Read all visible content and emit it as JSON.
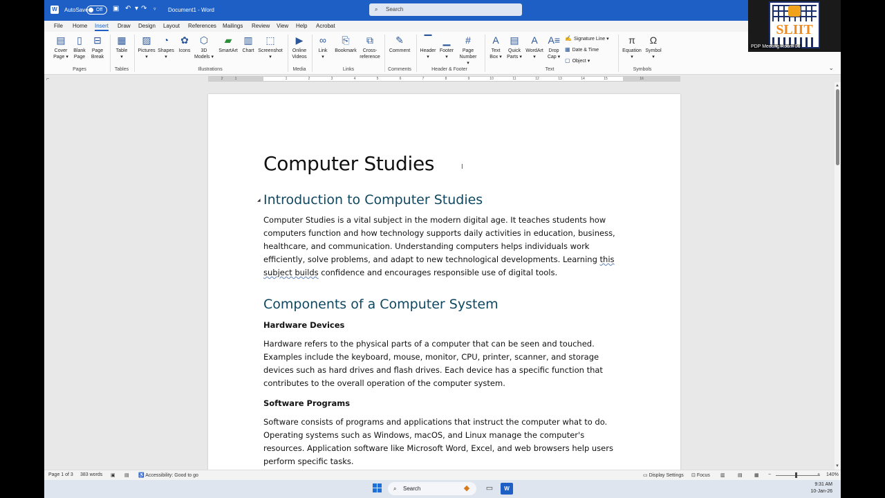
{
  "titlebar": {
    "autosave_label": "AutoSave",
    "autosave_state": "Off",
    "doc_title": "Document1 - Word",
    "search_placeholder": "Search"
  },
  "tabs": [
    "File",
    "Home",
    "Insert",
    "Draw",
    "Design",
    "Layout",
    "References",
    "Mailings",
    "Review",
    "View",
    "Help",
    "Acrobat"
  ],
  "active_tab": "Insert",
  "ribbon": {
    "cover_page": [
      "Cover",
      "Page ▾"
    ],
    "blank_page": [
      "Blank",
      "Page"
    ],
    "page_break": [
      "Page",
      "Break"
    ],
    "table": "Table",
    "pictures": "Pictures",
    "shapes": "Shapes",
    "icons": "Icons",
    "models_3d": [
      "3D",
      "Models ▾"
    ],
    "smartart": "SmartArt",
    "chart": "Chart",
    "screenshot": "Screenshot",
    "online_videos": [
      "Online",
      "Videos"
    ],
    "link": "Link",
    "bookmark": "Bookmark",
    "cross_reference": [
      "Cross-",
      "reference"
    ],
    "comment": "Comment",
    "header": "Header",
    "footer": "Footer",
    "page_number": [
      "Page",
      "Number ▾"
    ],
    "text_box": [
      "Text",
      "Box ▾"
    ],
    "quick_parts": [
      "Quick",
      "Parts ▾"
    ],
    "wordart": "WordArt",
    "drop_cap": [
      "Drop",
      "Cap ▾"
    ],
    "signature_line": "Signature Line",
    "date_time": "Date & Time",
    "object": "Object",
    "equation": "Equation",
    "symbol": "Symbol",
    "groups": {
      "pages": "Pages",
      "tables": "Tables",
      "illustrations": "Illustrations",
      "media": "Media",
      "links": "Links",
      "comments": "Comments",
      "header_footer": "Header & Footer",
      "text": "Text",
      "symbols": "Symbols"
    }
  },
  "ruler_numbers": [
    "1",
    "2",
    "1",
    "2",
    "3",
    "4",
    "5",
    "6",
    "7",
    "8",
    "9",
    "10",
    "11",
    "12",
    "13",
    "14",
    "15",
    "16"
  ],
  "document": {
    "title": "Computer Studies",
    "h1_intro": "Introduction to Computer Studies",
    "intro_para_main": "Computer Studies is a vital subject in the modern digital age. It teaches students how computers function and how technology supports daily activities in education, business, healthcare, and communication. Understanding computers helps individuals work efficiently, solve problems, and adapt to new technological developments. Learning ",
    "intro_para_flagged": "this subject builds",
    "intro_para_end": " confidence and encourages responsible use of digital tools.",
    "h1_components": "Components of a Computer System",
    "h3_hardware": "Hardware Devices",
    "hardware_para": "Hardware refers to the physical parts of a computer that can be seen and touched. Examples include the keyboard, mouse, monitor, CPU, printer, scanner, and storage devices such as hard drives and flash drives. Each device has a specific function that contributes to the overall operation of the computer system.",
    "h3_software": "Software Programs",
    "software_para": "Software consists of programs and applications that instruct the computer what to do. Operating systems such as Windows, macOS, and Linux manage the computer's resources. Application software like Microsoft Word, Excel, and web browsers help users perform specific tasks."
  },
  "status": {
    "page": "Page 1 of 3",
    "words": "383 words",
    "accessibility": "Accessibility: Good to go",
    "display_settings": "Display Settings",
    "focus": "Focus",
    "zoom": "140%"
  },
  "taskbar": {
    "search": "Search",
    "time": "9:31 AM",
    "date": "10-Jan-26"
  },
  "overlay": {
    "logo_text": "SLIIT",
    "participant": "PDP Meeting Room 06"
  },
  "colors": {
    "titlebar": "#1d5fc4",
    "heading": "#0f4761"
  }
}
